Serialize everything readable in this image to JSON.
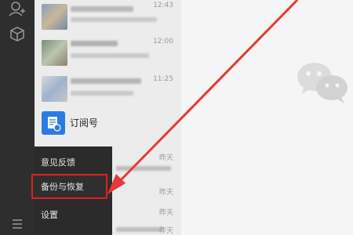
{
  "chats": {
    "items": [
      {
        "time": "12:43"
      },
      {
        "time": "12:00"
      },
      {
        "time": "11:25"
      }
    ],
    "subscription": {
      "name": "订阅号"
    },
    "day_labels": [
      "昨天",
      "昨天",
      "昨天",
      "昨天"
    ]
  },
  "menu": {
    "feedback": "意见反馈",
    "backup": "备份与恢复",
    "settings": "设置"
  },
  "colors": {
    "rail": "#2e2e2e",
    "menu": "#2b2b2b",
    "highlight": "#e02020",
    "arrow": "#e53935",
    "subscription_icon": "#2c7be5"
  },
  "icons": [
    "contacts-icon",
    "box-icon",
    "menu-icon",
    "subscription-icon",
    "wechat-logo-icon"
  ]
}
